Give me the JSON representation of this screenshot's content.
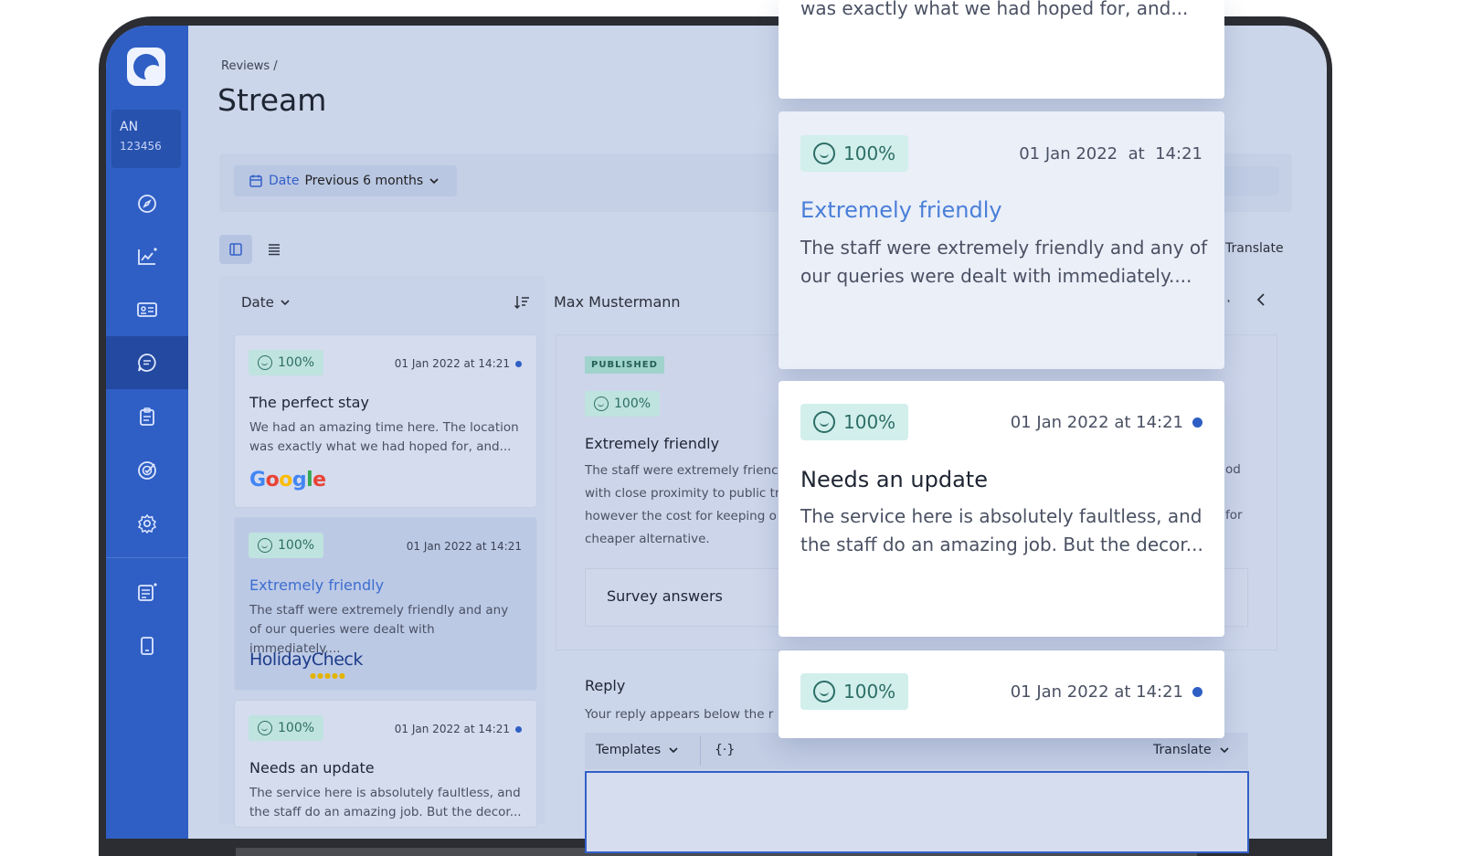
{
  "sidebar": {
    "account": {
      "initials": "AN",
      "id": "123456"
    }
  },
  "breadcrumb": "Reviews  /",
  "page_title": "Stream",
  "filter": {
    "label": "Date",
    "value": "Previous 6 months"
  },
  "toolbar_top": {
    "translate": "Translate"
  },
  "list": {
    "sort_label": "Date",
    "reviewer_name": "Max Mustermann",
    "cards": [
      {
        "score": "100%",
        "date": "01 Jan 2022 at 14:21",
        "title": "The perfect stay",
        "body": "We had an amazing time here. The location was exactly what we had hoped for, and...",
        "source": "Google"
      },
      {
        "score": "100%",
        "date": "01 Jan 2022 at 14:21",
        "title": "Extremely friendly",
        "body": "The staff were extremely friendly and any of our queries were dealt with immediately....",
        "source": "HolidayCheck",
        "source_stars": "●●●●●"
      },
      {
        "score": "100%",
        "date": "01 Jan 2022 at 14:21",
        "title": "Needs an update",
        "body": "The service here is absolutely faultless, and the staff do an amazing job. But the decor..."
      }
    ]
  },
  "detail": {
    "status": "PUBLISHED",
    "score": "100%",
    "title": "Extremely friendly",
    "body_lines": [
      "The staff were extremely frienc",
      "with close proximity to public tr",
      "however the cost for keeping o",
      "cheaper alternative."
    ],
    "right_fragment_1": "od",
    "right_fragment_2": "for",
    "survey_label": "Survey answers",
    "reply_label": "Reply",
    "reply_sub": "Your reply appears below the r",
    "templates_label": "Templates",
    "braces": "{·}",
    "translate": "Translate"
  },
  "floating": [
    {
      "partial_text": "was exactly what we had hoped for, and..."
    },
    {
      "score": "100%",
      "date": "01 Jan 2022  at  14:21",
      "title": "Extremely friendly",
      "body": "The staff were extremely friendly and any of our queries were dealt with immediately...."
    },
    {
      "score": "100%",
      "date": "01 Jan 2022 at 14:21",
      "title": "Needs an update",
      "body": "The service here is absolutely faultless, and the staff do an amazing job. But the decor..."
    },
    {
      "score": "100%",
      "date": "01 Jan 2022 at 14:21"
    }
  ]
}
